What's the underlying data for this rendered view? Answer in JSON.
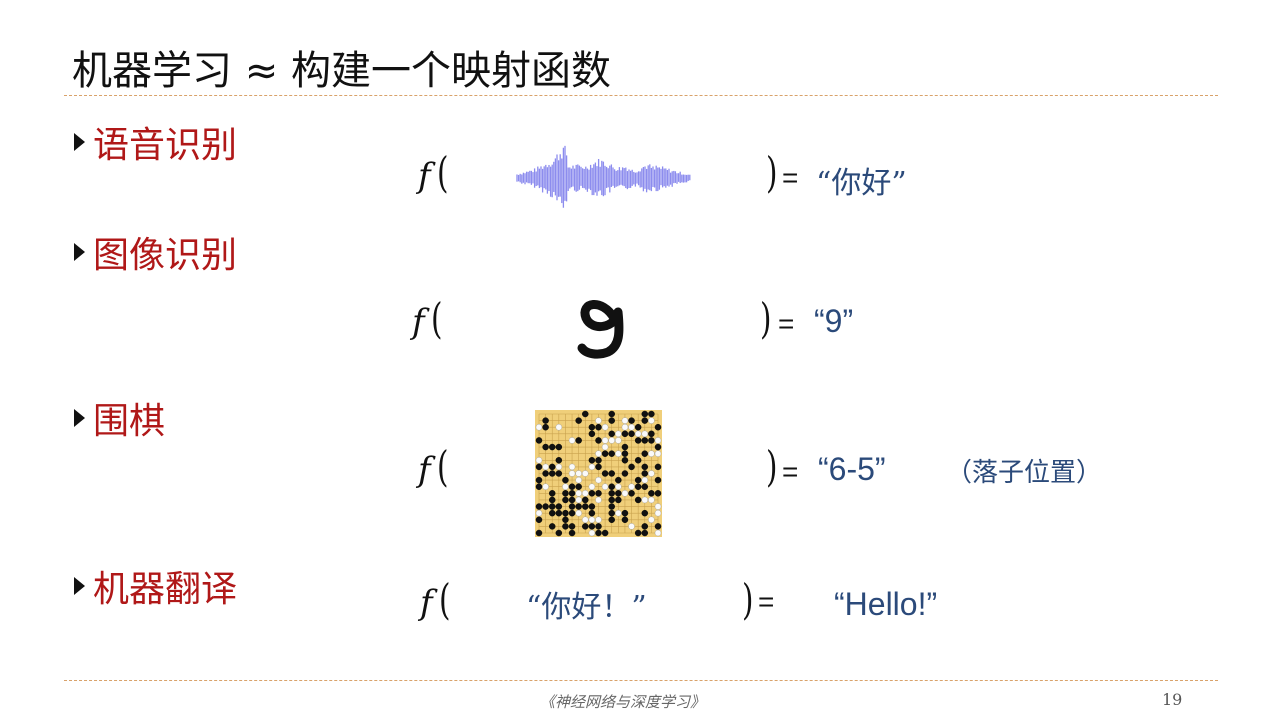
{
  "title": "机器学习 ≈ 构建一个映射函数",
  "rows": [
    {
      "label": "语音识别",
      "f": "f",
      "input": "",
      "equals": "=",
      "output": "“你好”"
    },
    {
      "label": "图像识别",
      "f": "f",
      "input": "9",
      "equals": "=",
      "output": "“9”"
    },
    {
      "label": "围棋",
      "f": "f",
      "input": "",
      "equals": "=",
      "output": "“6-5”",
      "note": "（落子位置）"
    },
    {
      "label": "机器翻译",
      "f": "f",
      "input": "“你好！”",
      "equals": "=",
      "output": "“Hello!”"
    }
  ],
  "footer": {
    "book": "《神经网络与深度学习》",
    "page": "19"
  },
  "colors": {
    "bullet_text": "#b01818",
    "output_text": "#2b4a7a",
    "rule": "#d9a26a",
    "waveform": "#8c8cee",
    "board": "#f0cf7a"
  },
  "icons": [
    "bullet-triangle-icon",
    "waveform-image",
    "handwritten-digit-image",
    "go-board-image"
  ]
}
